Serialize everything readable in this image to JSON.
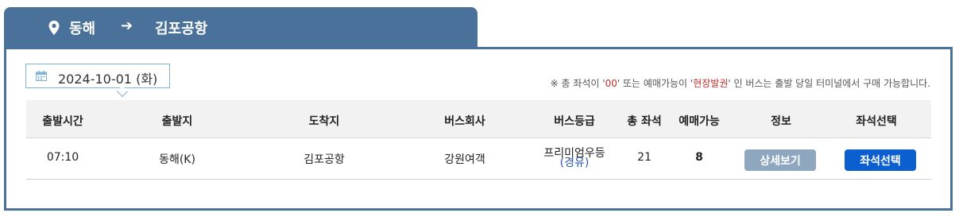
{
  "route": {
    "origin": "동해",
    "arrow": "➔",
    "destination": "김포공항"
  },
  "date": {
    "value": "2024-10-01 (화)"
  },
  "notice": {
    "prefix": "※ 총 좌석이 '",
    "zero": "00",
    "middle": "' 또는 예매가능이 '",
    "onsite": "현장발권",
    "suffix": "' 인 버스는 출발 당일 터미널에서 구매 가능합니다."
  },
  "table": {
    "headers": [
      "출발시간",
      "출발지",
      "도착지",
      "버스회사",
      "버스등급",
      "총 좌석",
      "예매가능",
      "정보",
      "좌석선택"
    ],
    "rows": [
      {
        "time": "07:10",
        "origin": "동해(K)",
        "destination": "김포공항",
        "company": "강원여객",
        "grade": "프리미엄우등",
        "grade_note": "(경유)",
        "total_seats": "21",
        "available": "8",
        "detail_label": "상세보기",
        "select_label": "좌석선택"
      }
    ]
  },
  "colors": {
    "header_bar": "#4a7199",
    "detail_button": "#8fa6bf",
    "select_button": "#0c5fce",
    "notice_highlight": "#c0302b"
  }
}
